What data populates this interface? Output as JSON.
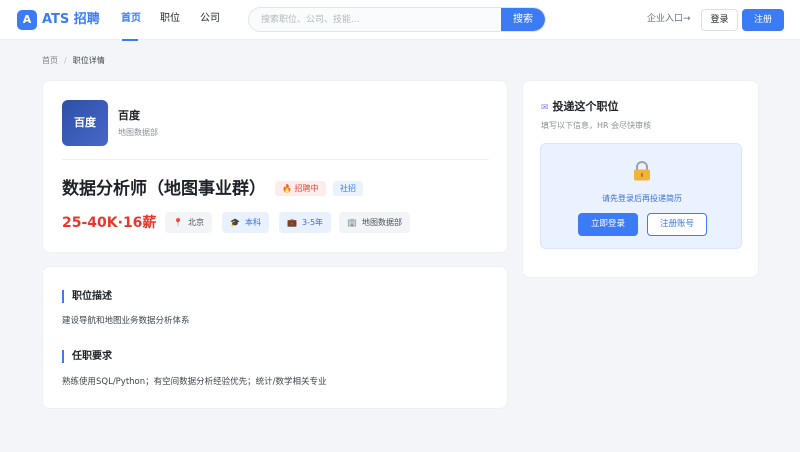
{
  "header": {
    "logo_letter": "A",
    "brand": "ATS 招聘",
    "nav": [
      {
        "label": "首页",
        "active": true
      },
      {
        "label": "职位",
        "active": false
      },
      {
        "label": "公司",
        "active": false
      }
    ],
    "search": {
      "placeholder": "搜索职位、公司、技能...",
      "button": "搜索"
    },
    "enterprise_link": "企业入口→",
    "login": "登录",
    "register": "注册"
  },
  "breadcrumb": {
    "home": "首页",
    "separator": "/",
    "current": "职位详情"
  },
  "company": {
    "logo_text": "百度",
    "name": "百度",
    "department": "地图数据部"
  },
  "job": {
    "title": "数据分析师（地图事业群）",
    "status_badge": "招聘中",
    "type_badge": "社招",
    "salary": "25-40K·16薪",
    "tags": [
      {
        "icon": "pin-icon",
        "label": "北京"
      },
      {
        "icon": "graduation-cap-icon",
        "label": "本科"
      },
      {
        "icon": "briefcase-icon",
        "label": "3-5年"
      },
      {
        "icon": "building-icon",
        "label": "地图数据部"
      }
    ]
  },
  "description": {
    "section1_title": "职位描述",
    "section1_text": "建设导航和地图业务数据分析体系",
    "section2_title": "任职要求",
    "section2_text": "熟练使用SQL/Python；有空间数据分析经验优先；统计/数学相关专业"
  },
  "apply": {
    "title": "投递这个职位",
    "subtitle": "填写以下信息，HR 会尽快审核",
    "login_prompt": "请先登录后再投递简历",
    "login_button": "立即登录",
    "register_button": "注册账号"
  },
  "colors": {
    "accent": "#3b7cf6",
    "salary": "#e8372b",
    "hiring": "#e24a3b"
  }
}
